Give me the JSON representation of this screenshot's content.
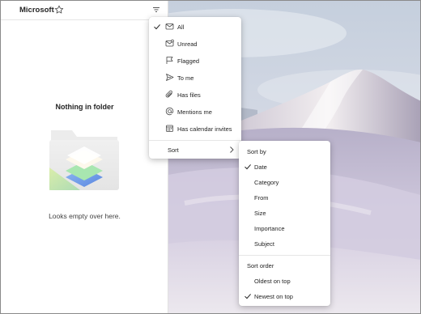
{
  "header": {
    "folder_name": "Microsoft",
    "star_icon": "star-icon",
    "filter_icon": "filter-icon"
  },
  "empty_state": {
    "title": "Nothing in folder",
    "subtitle": "Looks empty over here.",
    "illustration": "empty-folder-illustration"
  },
  "filter_menu": {
    "items": [
      {
        "label": "All",
        "icon": "mail-icon",
        "checked": true
      },
      {
        "label": "Unread",
        "icon": "mail-unread-icon",
        "checked": false
      },
      {
        "label": "Flagged",
        "icon": "flag-icon",
        "checked": false
      },
      {
        "label": "To me",
        "icon": "send-icon",
        "checked": false
      },
      {
        "label": "Has files",
        "icon": "attach-icon",
        "checked": false
      },
      {
        "label": "Mentions me",
        "icon": "mention-icon",
        "checked": false
      },
      {
        "label": "Has calendar invites",
        "icon": "calendar-icon",
        "checked": false
      }
    ],
    "sort_label": "Sort"
  },
  "sort_menu": {
    "sort_by_header": "Sort by",
    "sort_by": [
      {
        "label": "Date",
        "checked": true
      },
      {
        "label": "Category",
        "checked": false
      },
      {
        "label": "From",
        "checked": false
      },
      {
        "label": "Size",
        "checked": false
      },
      {
        "label": "Importance",
        "checked": false
      },
      {
        "label": "Subject",
        "checked": false
      }
    ],
    "sort_order_header": "Sort order",
    "sort_order": [
      {
        "label": "Oldest on top",
        "checked": false
      },
      {
        "label": "Newest on top",
        "checked": true
      }
    ]
  }
}
